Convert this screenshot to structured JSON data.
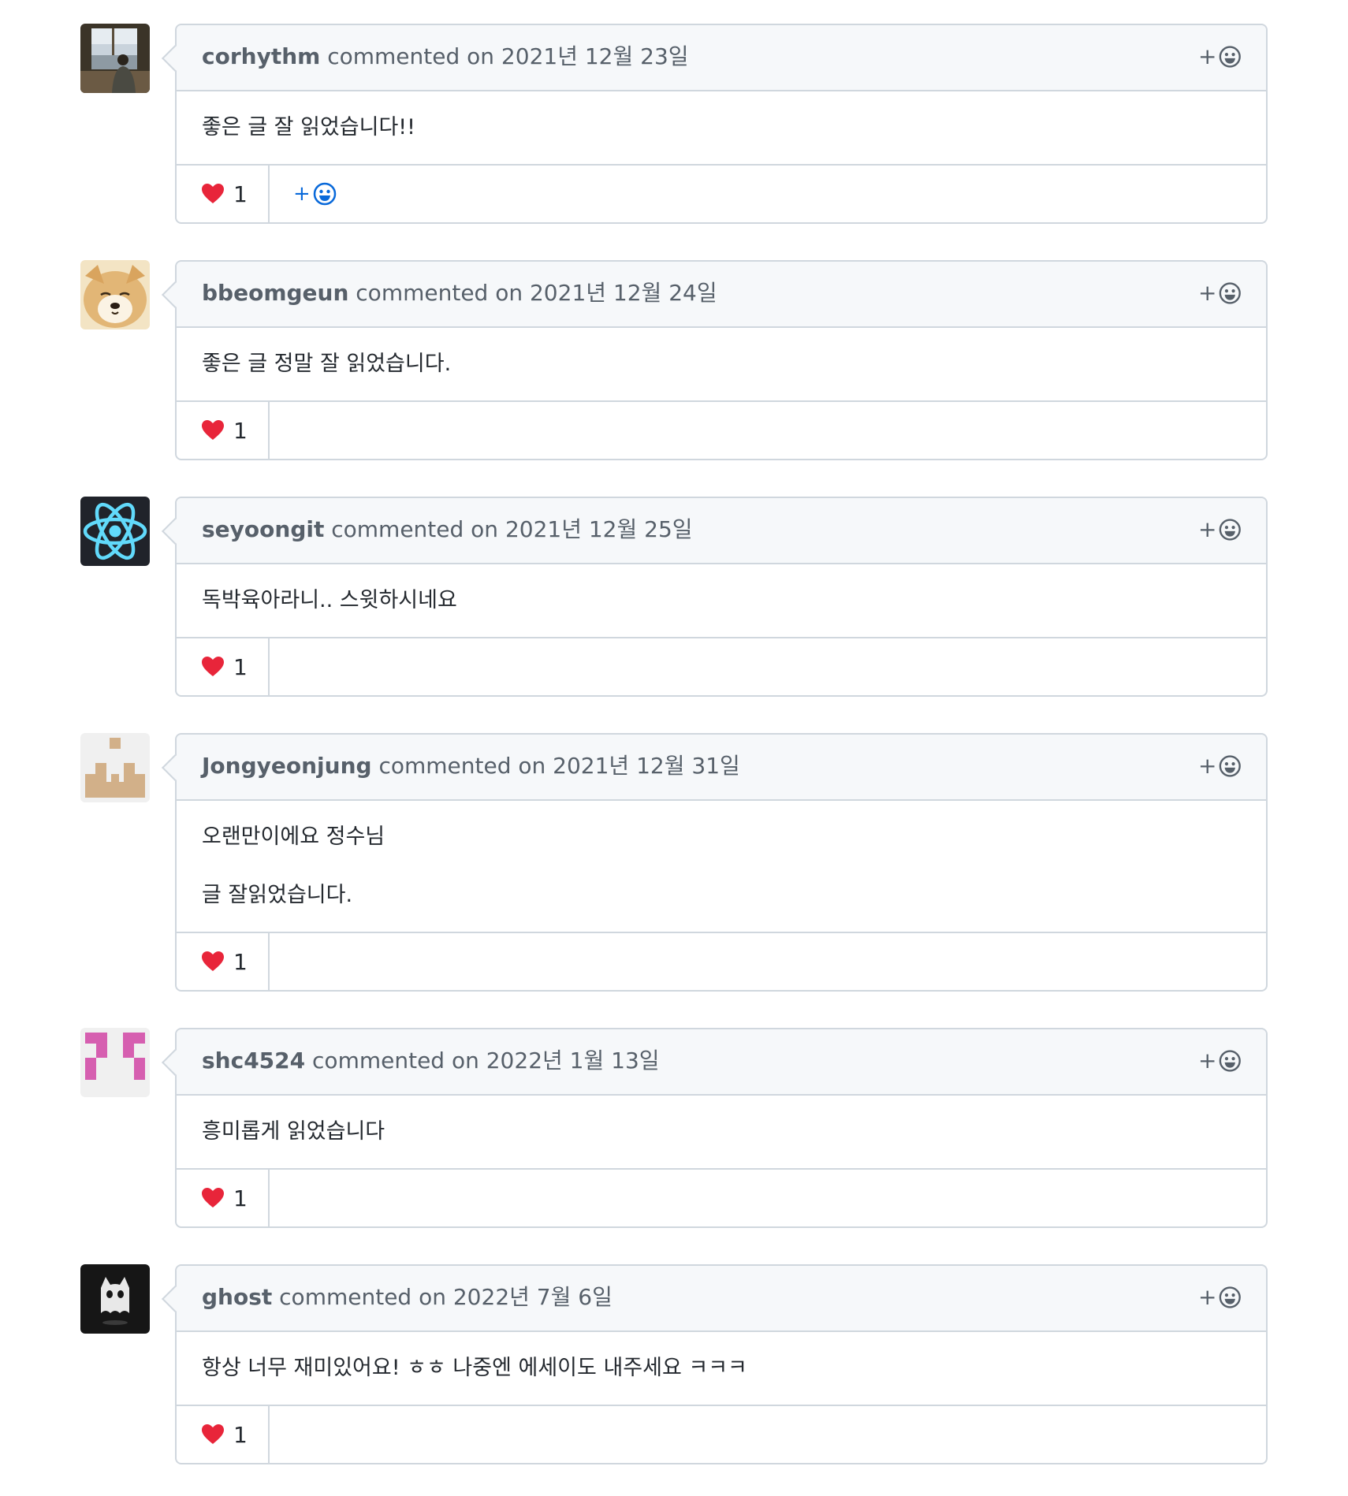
{
  "comments": [
    {
      "author": "corhythm",
      "meta": " commented on 2021년 12월 23일",
      "paragraphs": [
        "좋은 글 잘 읽었습니다!!"
      ],
      "reaction_emoji": "heart",
      "reaction_count": "1",
      "avatar": "photo-person-at-window"
    },
    {
      "author": "bbeomgeun",
      "meta": " commented on 2021년 12월 24일",
      "paragraphs": [
        "좋은 글 정말 잘 읽었습니다."
      ],
      "reaction_emoji": "heart",
      "reaction_count": "1",
      "avatar": "photo-shiba-dog"
    },
    {
      "author": "seyoongit",
      "meta": " commented on 2021년 12월 25일",
      "paragraphs": [
        "독박육아라니.. 스윗하시네요"
      ],
      "reaction_emoji": "heart",
      "reaction_count": "1",
      "avatar": "react-logo"
    },
    {
      "author": "Jongyeonjung",
      "meta": " commented on 2021년 12월 31일",
      "paragraphs": [
        "오랜만이에요 정수님",
        "글 잘읽었습니다."
      ],
      "reaction_emoji": "heart",
      "reaction_count": "1",
      "avatar": "identicon-tan"
    },
    {
      "author": "shc4524",
      "meta": " commented on 2022년 1월 13일",
      "paragraphs": [
        "흥미롭게 읽었습니다"
      ],
      "reaction_emoji": "heart",
      "reaction_count": "1",
      "avatar": "identicon-pink"
    },
    {
      "author": "ghost",
      "meta": " commented on 2022년 7월 6일",
      "paragraphs": [
        "항상 너무 재미있어요! ㅎㅎ 나중엔 에세이도 내주세요 ㅋㅋㅋ"
      ],
      "reaction_emoji": "heart",
      "reaction_count": "1",
      "avatar": "ghost-octocat"
    }
  ],
  "colors": {
    "border": "#d0d7de",
    "header_bg": "#f6f8fa",
    "muted_text": "#57606a",
    "link_blue": "#0969da",
    "heart": "#e8253a"
  }
}
